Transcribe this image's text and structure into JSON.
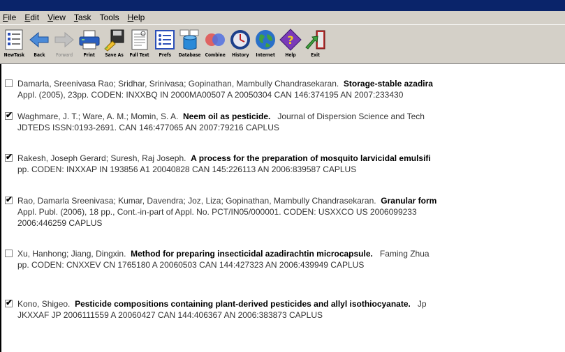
{
  "menu": {
    "items": [
      {
        "u": "F",
        "rest": "ile"
      },
      {
        "u": "E",
        "rest": "dit"
      },
      {
        "u": "V",
        "rest": "iew"
      },
      {
        "u": "T",
        "rest": "ask"
      },
      {
        "u": "To",
        "rest": "ols",
        "pre": ""
      },
      {
        "u": "H",
        "rest": "elp"
      }
    ]
  },
  "toolbar": {
    "buttons": [
      {
        "label": "NewTask",
        "icon": "new-task-icon",
        "enabled": true
      },
      {
        "label": "Back",
        "icon": "back-arrow-icon",
        "enabled": true
      },
      {
        "label": "Forward",
        "icon": "forward-arrow-icon",
        "enabled": false
      },
      {
        "label": "Print",
        "icon": "printer-icon",
        "enabled": true
      },
      {
        "label": "Save As",
        "icon": "save-as-icon",
        "enabled": true
      },
      {
        "label": "Full Text",
        "icon": "full-text-icon",
        "enabled": true
      },
      {
        "label": "Prefs",
        "icon": "prefs-icon",
        "enabled": true
      },
      {
        "label": "Database",
        "icon": "database-icon",
        "enabled": true
      },
      {
        "label": "Combine",
        "icon": "combine-icon",
        "enabled": true
      },
      {
        "label": "History",
        "icon": "history-icon",
        "enabled": true
      },
      {
        "label": "Internet",
        "icon": "globe-icon",
        "enabled": true
      },
      {
        "label": "Help",
        "icon": "help-icon",
        "enabled": true
      },
      {
        "label": "Exit",
        "icon": "exit-icon",
        "enabled": true
      }
    ]
  },
  "records": [
    {
      "checked": false,
      "authors": "Damarla, Sreenivasa Rao; Sridhar, Srinivasa; Gopinathan, Mambully Chandrasekaran.",
      "title": "Storage-stable azadira",
      "rest1": "",
      "line2": "Appl. (2005),    23pp.  CODEN: INXXBQ  IN  2000MA00507  A  20050304  CAN 146:374195  AN 2007:233430",
      "line3": ""
    },
    {
      "checked": true,
      "authors": "Waghmare, J. T.; Ware, A. M.; Momin, S. A.",
      "title": "Neem oil as pesticide.",
      "rest1": "Journal of Dispersion Science and Tech",
      "line2": "JDTEDS  ISSN:0193-2691.  CAN 146:477065  AN 2007:79216    CAPLUS",
      "line3": ""
    },
    {
      "checked": true,
      "authors": "Rakesh, Joseph Gerard; Suresh, Raj Joseph.",
      "title": "A process for the preparation of mosquito larvicidal emulsifi",
      "rest1": "",
      "line2": "pp.  CODEN: INXXAP  IN  193856  A1  20040828  CAN 145:226113  AN 2006:839587    CAPLUS",
      "line3": ""
    },
    {
      "checked": true,
      "authors": "Rao, Damarla Sreenivasa; Kumar, Davendra; Joz, Liza; Gopinathan, Mambully Chandrasekaran.",
      "title": "Granular form",
      "rest1": "",
      "line2": "Appl. Publ. (2006),    18 pp., Cont.-in-part of Appl. No. PCT/IN05/000001.  CODEN: USXXCO  US  2006099233",
      "line3": "2006:446259    CAPLUS"
    },
    {
      "checked": false,
      "authors": "Xu, Hanhong; Jiang, Dingxin.",
      "title": "Method for preparing insecticidal azadirachtin microcapsule.",
      "rest1": "Faming Zhua",
      "line2": "pp.  CODEN: CNXXEV  CN  1765180  A  20060503  CAN 144:427323  AN 2006:439949    CAPLUS",
      "line3": ""
    },
    {
      "checked": true,
      "authors": "Kono, Shigeo.",
      "title": "Pesticide compositions containing plant-derived pesticides and allyl isothiocyanate.",
      "rest1": "Jp",
      "line2": "JKXXAF  JP  2006111559  A  20060427  CAN 144:406367  AN 2006:383873    CAPLUS",
      "line3": ""
    }
  ],
  "colors": {
    "title_bar": "#0a246a",
    "chrome": "#d4d0c8"
  }
}
